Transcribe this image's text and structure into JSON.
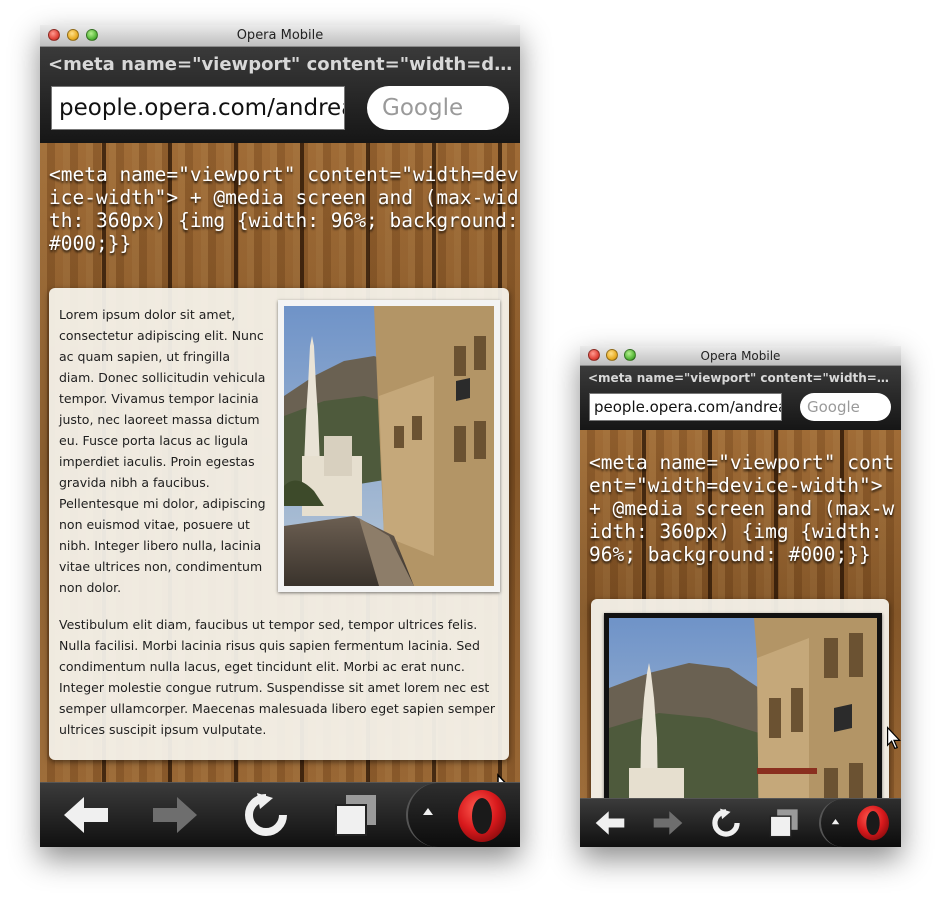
{
  "window_large": {
    "title": "Opera Mobile",
    "page_title": "<meta name=\"viewport\" content=\"width=device-width\">",
    "address": "people.opera.com/andreas/",
    "search_placeholder": "Google",
    "heading": "<meta name=\"viewport\" content=\"width=device-width\"> + @media screen and (max-width: 360px) {img {width: 96%; background: #000;}}",
    "paragraph1": "Lorem ipsum dolor sit amet, consectetur adipiscing elit. Nunc ac quam sapien, ut fringilla diam. Donec sollicitudin vehicula tempor. Vivamus tempor lacinia justo, nec laoreet massa dictum eu. Fusce porta lacus ac ligula imperdiet iaculis. Proin egestas gravida nibh a faucibus. Pellentesque mi dolor, adipiscing non euismod vitae, posuere ut nibh. Integer libero nulla, lacinia vitae ultrices non, condimentum non dolor.",
    "paragraph2": "Vestibulum elit diam, faucibus ut tempor sed, tempor ultrices felis. Nulla facilisi. Morbi lacinia risus quis sapien fermentum lacinia. Sed condimentum nulla lacus, eget tincidunt elit. Morbi ac erat nunc. Integer molestie congue rutrum. Suspendisse sit amet lorem nec est semper ullamcorper. Maecenas malesuada libero eget sapien semper ultrices suscipit ipsum vulputate."
  },
  "window_small": {
    "title": "Opera Mobile",
    "page_title": "<meta name=\"viewport\" content=\"width=device-width\">",
    "address": "people.opera.com/andreas/",
    "search_placeholder": "Google",
    "heading": "<meta name=\"viewport\" content=\"width=device-width\"> + @media screen and (max-width: 360px) {img {width: 96%; background: #000;}}"
  },
  "toolbar_icons": [
    "back-arrow-icon",
    "forward-arrow-icon",
    "reload-icon",
    "tabs-icon",
    "menu-caret-icon",
    "opera-logo-icon"
  ],
  "colors": {
    "opera_red": "#d8191c",
    "wood": "#8a5a2b",
    "toolbar": "#1a1a1a"
  }
}
